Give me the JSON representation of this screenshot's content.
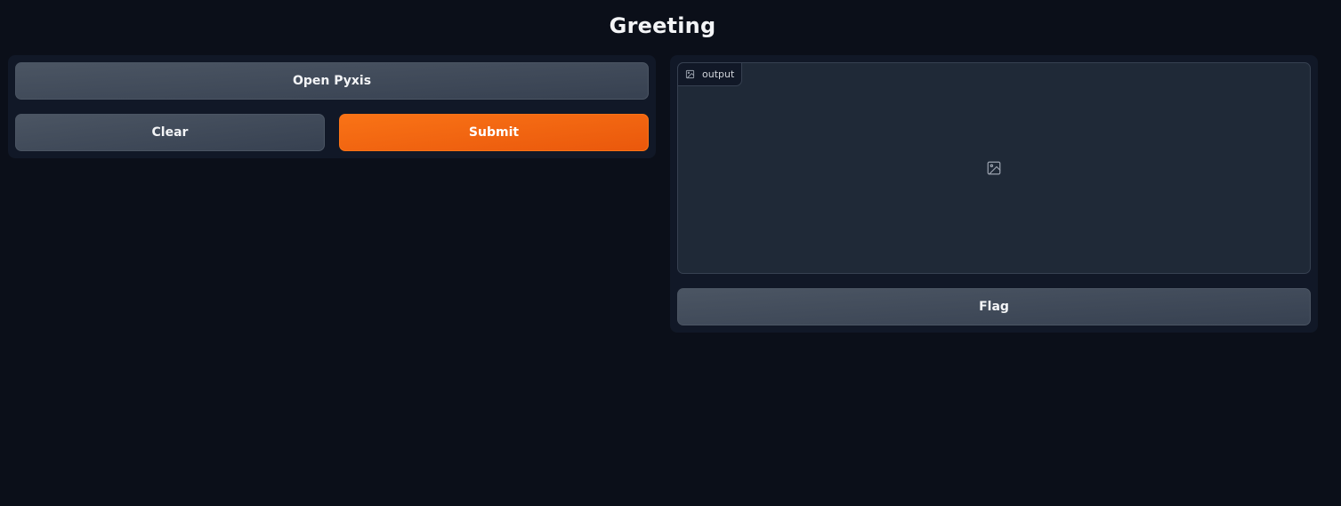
{
  "page": {
    "title": "Greeting"
  },
  "inputs_panel": {
    "open_pyxis_label": "Open Pyxis",
    "clear_label": "Clear",
    "submit_label": "Submit"
  },
  "outputs_panel": {
    "output_label": "output",
    "output_icon": "image-icon",
    "placeholder_icon": "image-placeholder-icon",
    "flag_label": "Flag"
  },
  "colors": {
    "background": "#0b0f19",
    "panel": "#111827",
    "primary": "#f97316",
    "secondary": "#4b5563"
  }
}
